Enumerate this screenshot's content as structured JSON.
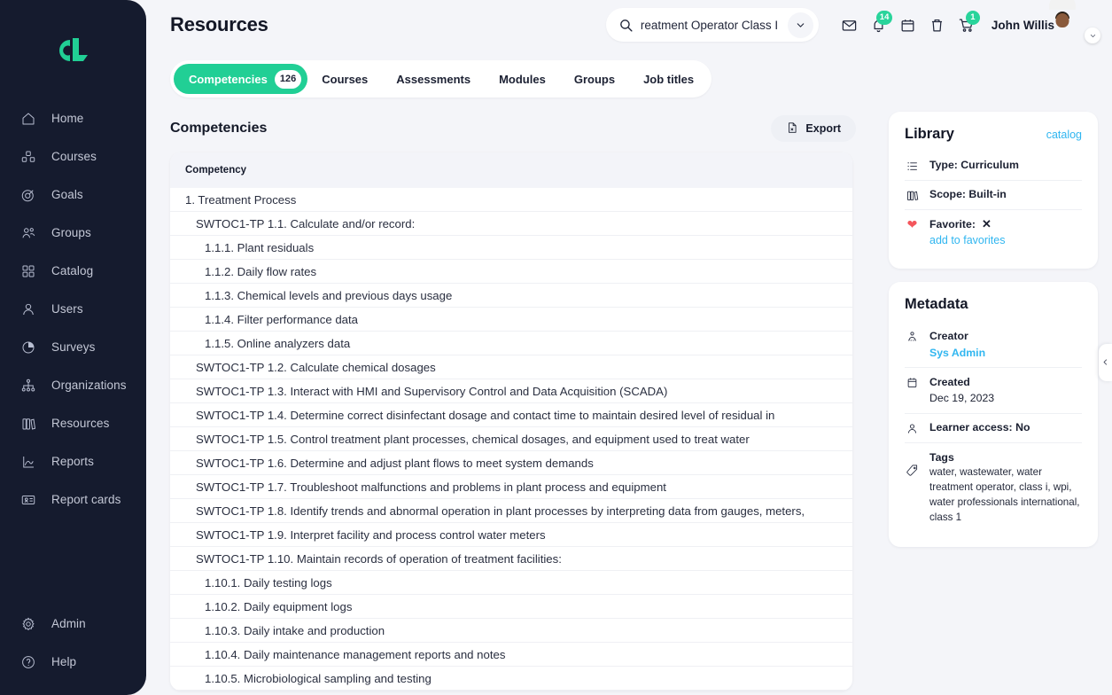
{
  "brand": {
    "logo_name": "cl-logo",
    "accent": "#21cf95",
    "sidebar_bg": "#151b2e",
    "page_bg": "#f4f5f9",
    "link_blue": "#30b6f0"
  },
  "sidebar": {
    "items": [
      {
        "label": "Home",
        "icon": "home-icon"
      },
      {
        "label": "Courses",
        "icon": "cubes-icon"
      },
      {
        "label": "Goals",
        "icon": "target-icon"
      },
      {
        "label": "Groups",
        "icon": "people-icon"
      },
      {
        "label": "Catalog",
        "icon": "grid-icon"
      },
      {
        "label": "Users",
        "icon": "user-icon"
      },
      {
        "label": "Surveys",
        "icon": "pie-chart-icon"
      },
      {
        "label": "Organizations",
        "icon": "org-tree-icon"
      },
      {
        "label": "Resources",
        "icon": "books-icon"
      },
      {
        "label": "Reports",
        "icon": "report-chart-icon"
      },
      {
        "label": "Report cards",
        "icon": "id-card-icon"
      }
    ],
    "bottom_items": [
      {
        "label": "Admin",
        "icon": "gear-icon"
      },
      {
        "label": "Help",
        "icon": "question-circle-icon"
      }
    ]
  },
  "header": {
    "title": "Resources",
    "search": {
      "value": "reatment Operator Class I",
      "placeholder": "Search",
      "icon": "search-icon",
      "dropdown_icon": "chevron-down-icon"
    },
    "icons": [
      {
        "name": "mail-icon",
        "badge": null
      },
      {
        "name": "bell-icon",
        "badge": "14"
      },
      {
        "name": "calendar-icon",
        "badge": null
      },
      {
        "name": "trash-icon",
        "badge": null
      },
      {
        "name": "cart-icon",
        "badge": "1"
      }
    ],
    "user": {
      "name": "John Willis",
      "avatar": "avatar",
      "chevron": "chevron-down-icon"
    }
  },
  "tabs": [
    {
      "label": "Competencies",
      "count": "126",
      "active": true
    },
    {
      "label": "Courses",
      "count": null,
      "active": false
    },
    {
      "label": "Assessments",
      "count": null,
      "active": false
    },
    {
      "label": "Modules",
      "count": null,
      "active": false
    },
    {
      "label": "Groups",
      "count": null,
      "active": false
    },
    {
      "label": "Job titles",
      "count": null,
      "active": false
    }
  ],
  "section": {
    "title": "Competencies",
    "export_label": "Export",
    "export_icon": "file-export-icon"
  },
  "table": {
    "column_header": "Competency",
    "rows": [
      {
        "text": "1. Treatment Process",
        "level": 1
      },
      {
        "text": "SWTOC1-TP 1.1. Calculate and/or record:",
        "level": 2
      },
      {
        "text": "1.1.1. Plant residuals",
        "level": 3
      },
      {
        "text": "1.1.2. Daily flow rates",
        "level": 3
      },
      {
        "text": "1.1.3. Chemical levels and previous days usage",
        "level": 3
      },
      {
        "text": "1.1.4. Filter performance data",
        "level": 3
      },
      {
        "text": "1.1.5. Online analyzers data",
        "level": 3
      },
      {
        "text": "SWTOC1-TP 1.2. Calculate chemical dosages",
        "level": 2
      },
      {
        "text": "SWTOC1-TP 1.3. Interact with HMI and Supervisory Control and Data Acquisition (SCADA)",
        "level": 2
      },
      {
        "text": "SWTOC1-TP 1.4. Determine correct disinfectant dosage and contact time to maintain desired level of residual in",
        "level": 2
      },
      {
        "text": "SWTOC1-TP 1.5. Control treatment plant processes, chemical dosages, and equipment used to treat water",
        "level": 2
      },
      {
        "text": "SWTOC1-TP 1.6. Determine and adjust plant flows to meet system demands",
        "level": 2
      },
      {
        "text": "SWTOC1-TP 1.7. Troubleshoot malfunctions and problems in plant process and equipment",
        "level": 2
      },
      {
        "text": "SWTOC1-TP 1.8. Identify trends and abnormal operation in plant processes by interpreting data from gauges, meters,",
        "level": 2
      },
      {
        "text": "SWTOC1-TP 1.9. Interpret facility and process control water meters",
        "level": 2
      },
      {
        "text": "SWTOC1-TP 1.10. Maintain records of operation of treatment facilities:",
        "level": 2
      },
      {
        "text": "1.10.1. Daily testing logs",
        "level": 3
      },
      {
        "text": "1.10.2. Daily equipment logs",
        "level": 3
      },
      {
        "text": "1.10.3. Daily intake and production",
        "level": 3
      },
      {
        "text": "1.10.4. Daily maintenance management reports and notes",
        "level": 3
      },
      {
        "text": "1.10.5. Microbiological sampling and testing",
        "level": 3
      }
    ]
  },
  "library": {
    "title": "Library",
    "catalog_link": "catalog",
    "type": "Type: Curriculum",
    "type_icon": "list-icon",
    "scope": "Scope: Built-in",
    "scope_icon": "books-icon",
    "favorite_label": "Favorite:",
    "favorite_value": "✕",
    "favorite_icon": "heart-icon",
    "add_to_favorites": "add to favorites"
  },
  "metadata": {
    "title": "Metadata",
    "creator_label": "Creator",
    "creator_value": "Sys Admin",
    "creator_icon": "creator-icon",
    "created_label": "Created",
    "created_value": "Dec 19, 2023",
    "created_icon": "calendar-icon",
    "learner_access": "Learner access: No",
    "learner_icon": "user-icon",
    "tags_label": "Tags",
    "tags_value": "water, wastewater, water treatment operator, class i, wpi, water professionals international, class 1",
    "tags_icon": "tag-icon"
  },
  "collapse_panel": {
    "icon": "chevron-left-icon"
  }
}
